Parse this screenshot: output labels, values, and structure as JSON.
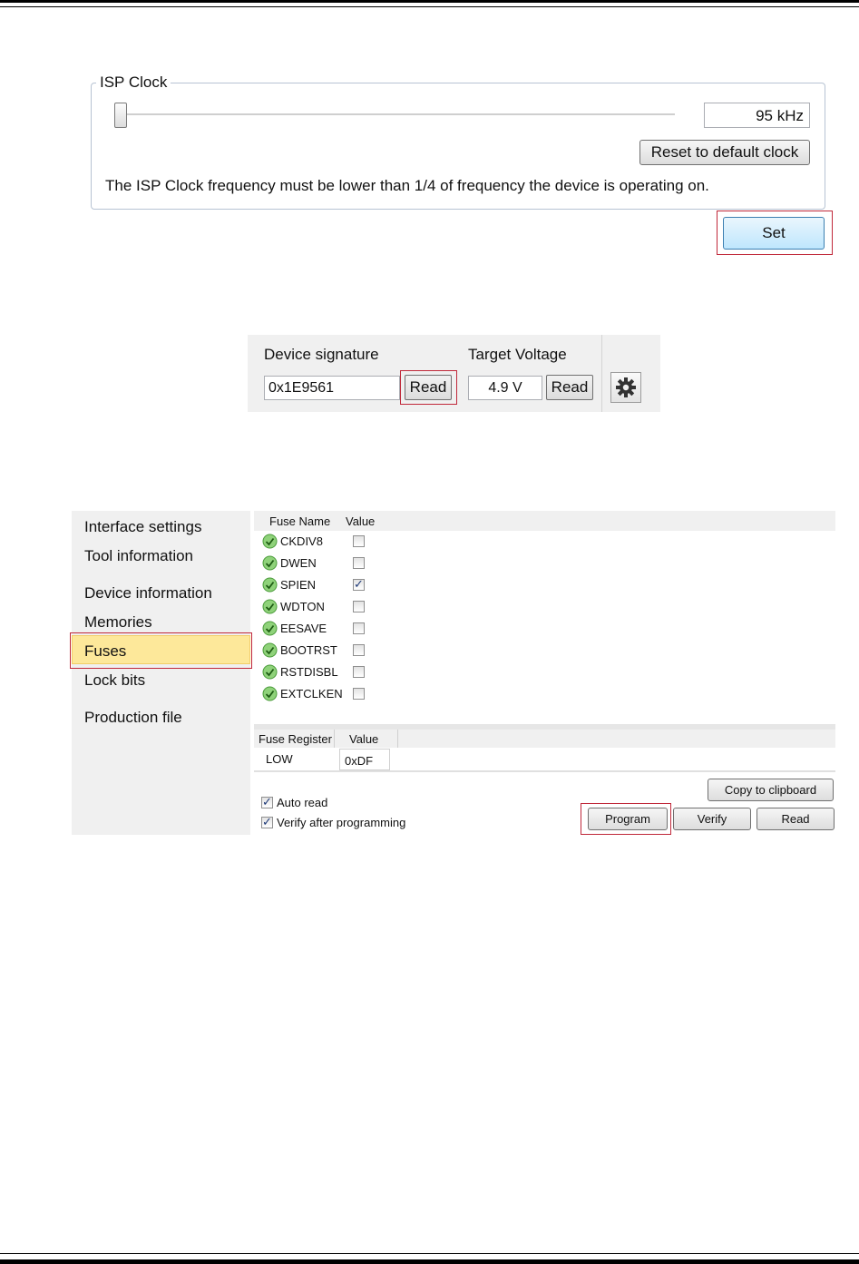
{
  "isp_clock": {
    "legend": "ISP Clock",
    "slider_value_fraction": 0.0,
    "value": "95 kHz",
    "reset_label": "Reset to default clock",
    "note": "The ISP Clock frequency must be lower than 1/4 of frequency the device is operating on.",
    "set_label": "Set"
  },
  "device": {
    "signature_label": "Device signature",
    "signature_value": "0x1E9561",
    "read_label": "Read",
    "voltage_label": "Target Voltage",
    "voltage_value": "4.9 V",
    "voltage_read_label": "Read"
  },
  "nav": {
    "items": [
      "Interface settings",
      "Tool information",
      "Device information",
      "Memories",
      "Fuses",
      "Lock bits",
      "Production file"
    ],
    "selected": "Fuses"
  },
  "fuses": {
    "col_name": "Fuse Name",
    "col_value": "Value",
    "rows": [
      {
        "name": "CKDIV8",
        "checked": false
      },
      {
        "name": "DWEN",
        "checked": false
      },
      {
        "name": "SPIEN",
        "checked": true
      },
      {
        "name": "WDTON",
        "checked": false
      },
      {
        "name": "EESAVE",
        "checked": false
      },
      {
        "name": "BOOTRST",
        "checked": false
      },
      {
        "name": "RSTDISBL",
        "checked": false
      },
      {
        "name": "EXTCLKEN",
        "checked": false
      }
    ],
    "reg_col_name": "Fuse Register",
    "reg_col_value": "Value",
    "reg_name": "LOW",
    "reg_value": "0xDF",
    "copy_label": "Copy to clipboard",
    "auto_read_label": "Auto read",
    "verify_after_label": "Verify after programming",
    "program_label": "Program",
    "verify_label": "Verify",
    "read_label": "Read"
  },
  "colors": {
    "highlight": "#c0283a",
    "selected_nav": "#fde89a",
    "ok_green": "#4caf3a"
  }
}
